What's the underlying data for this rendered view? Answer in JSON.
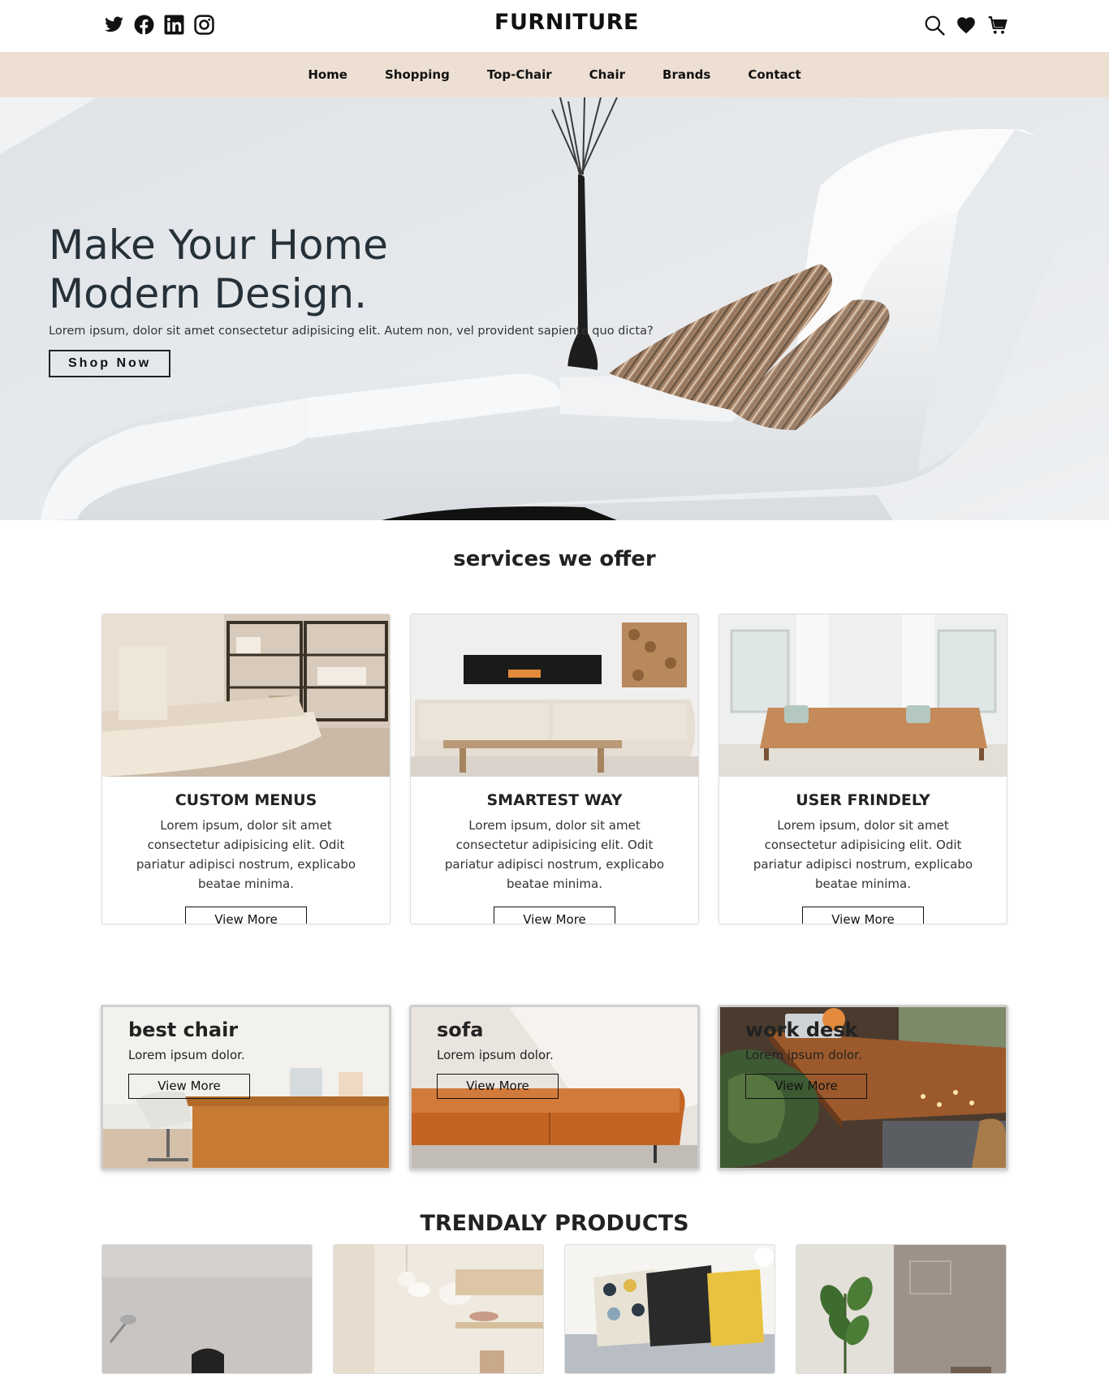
{
  "header": {
    "brand": "FURNITURE",
    "social_icons": [
      "twitter-icon",
      "facebook-icon",
      "linkedin-icon",
      "instagram-icon"
    ],
    "tool_icons": [
      "search-icon",
      "heart-icon",
      "cart-icon"
    ]
  },
  "nav": {
    "items": [
      {
        "label": "Home"
      },
      {
        "label": "Shopping"
      },
      {
        "label": "Top-Chair"
      },
      {
        "label": "Chair"
      },
      {
        "label": "Brands"
      },
      {
        "label": "Contact"
      }
    ],
    "background": "#ede0d3"
  },
  "hero": {
    "title": "Make Your Home Modern Design.",
    "description": "Lorem ipsum, dolor sit amet consectetur adipisicing elit. Autem non, vel provident sapiente quo dicta?",
    "button": "Shop Now"
  },
  "services": {
    "title": "services we offer",
    "cards": [
      {
        "title": "CUSTOM MENUS",
        "text": "Lorem ipsum, dolor sit amet consectetur adipisicing elit. Odit pariatur adipisci nostrum, explicabo beatae minima.",
        "button": "View More"
      },
      {
        "title": "SMARTEST WAY",
        "text": "Lorem ipsum, dolor sit amet consectetur adipisicing elit. Odit pariatur adipisci nostrum, explicabo beatae minima.",
        "button": "View More"
      },
      {
        "title": "USER FRINDELY",
        "text": "Lorem ipsum, dolor sit amet consectetur adipisicing elit. Odit pariatur adipisci nostrum, explicabo beatae minima.",
        "button": "View More"
      }
    ]
  },
  "categories": [
    {
      "title": "best chair",
      "subtitle": "Lorem ipsum dolor.",
      "button": "View More"
    },
    {
      "title": "sofa",
      "subtitle": "Lorem ipsum dolor.",
      "button": "View More"
    },
    {
      "title": "work desk",
      "subtitle": "Lorem ipsum dolor.",
      "button": "View More"
    }
  ],
  "trending": {
    "title": "TRENDALY PRODUCTS"
  }
}
